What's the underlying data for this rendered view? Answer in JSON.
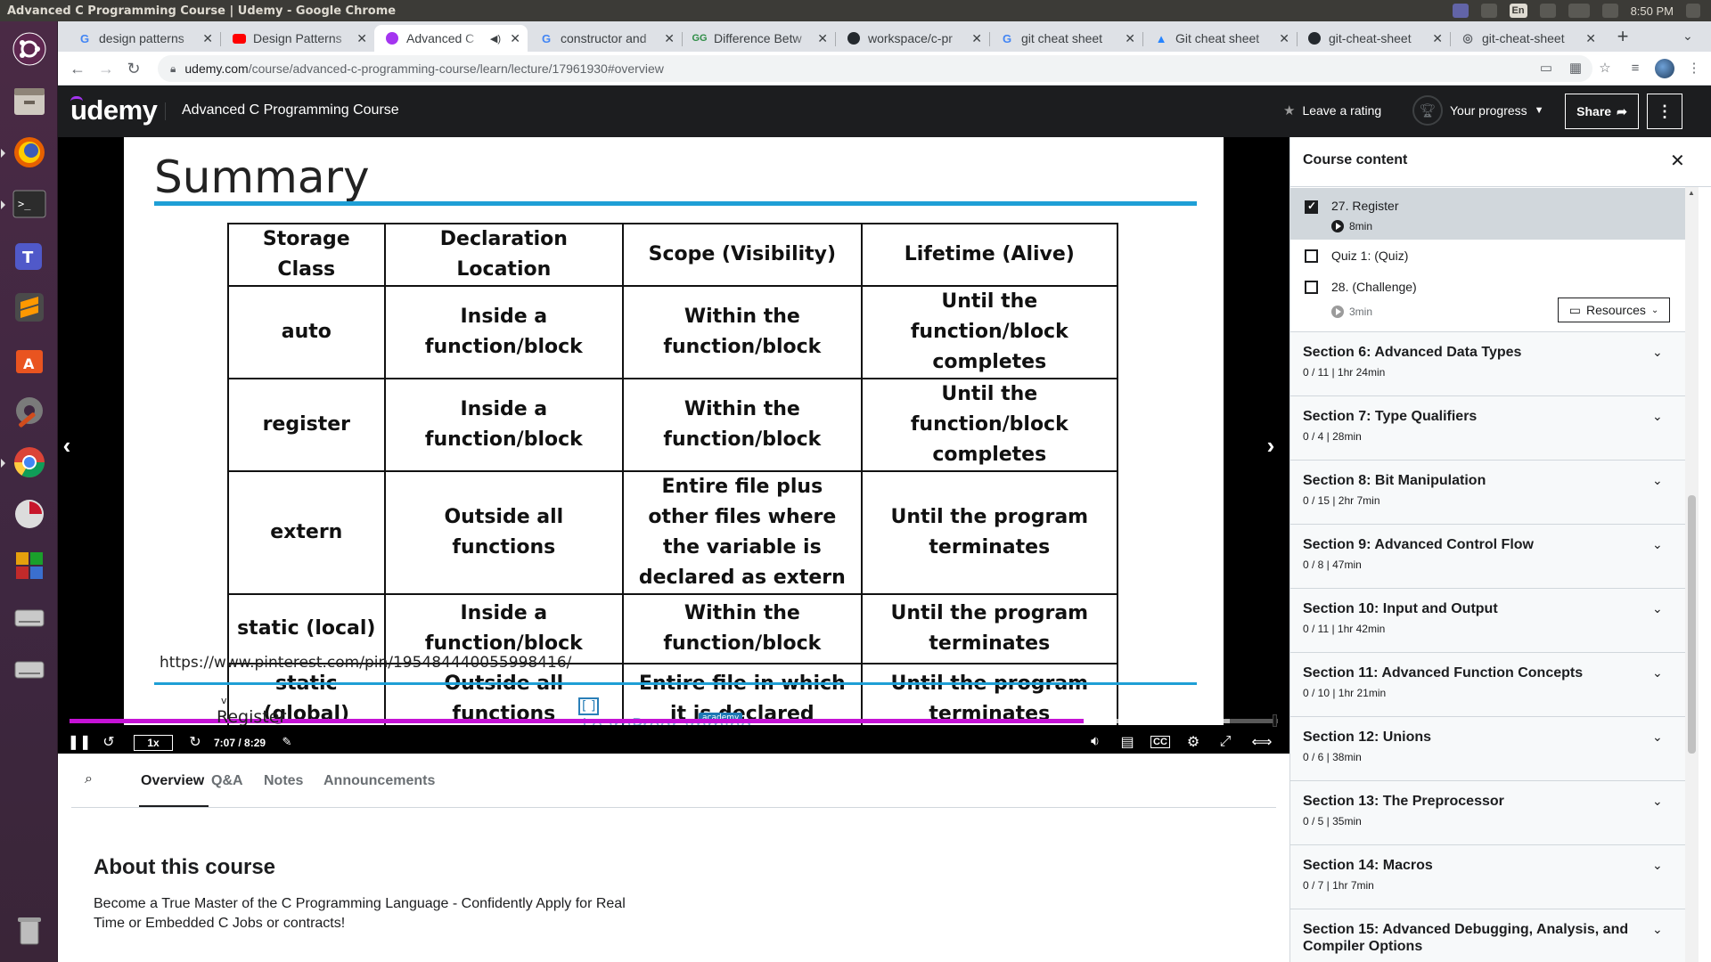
{
  "os": {
    "window_title": "Advanced C Programming Course | Udemy - Google Chrome",
    "clock": "8:50 PM",
    "keyboard_layout": "En"
  },
  "browser": {
    "tabs": [
      {
        "title": "design patterns",
        "favicon": "google-icon",
        "active": false
      },
      {
        "title": "Design Patterns",
        "favicon": "youtube-icon",
        "active": false
      },
      {
        "title": "Advanced C",
        "favicon": "udemy-icon",
        "active": true
      },
      {
        "title": "constructor and",
        "favicon": "google-icon",
        "active": false
      },
      {
        "title": "Difference Betw",
        "favicon": "geeksforgeeks-icon",
        "active": false
      },
      {
        "title": "workspace/c-pr",
        "favicon": "github-icon",
        "active": false
      },
      {
        "title": "git cheat sheet",
        "favicon": "google-icon",
        "active": false
      },
      {
        "title": "Git cheat sheet",
        "favicon": "atlassian-icon",
        "active": false
      },
      {
        "title": "git-cheat-sheet",
        "favicon": "github-icon",
        "active": false
      },
      {
        "title": "git-cheat-sheet",
        "favicon": "globe-icon",
        "active": false
      }
    ],
    "url_host": "udemy.com",
    "url_path": "/course/advanced-c-programming-course/learn/lecture/17961930#overview"
  },
  "header": {
    "logo": "udemy",
    "course_title": "Advanced C Programming Course",
    "leave_rating": "Leave a rating",
    "your_progress": "Your progress",
    "share": "Share"
  },
  "slide": {
    "title": "Summary",
    "table_headers": [
      "Storage Class",
      "Declaration Location",
      "Scope (Visibility)",
      "Lifetime (Alive)"
    ],
    "rows": [
      [
        "auto",
        "Inside a function/block",
        "Within the function/block",
        "Until the function/block completes"
      ],
      [
        "register",
        "Inside a function/block",
        "Within the function/block",
        "Until the function/block completes"
      ],
      [
        "extern",
        "Outside all functions",
        "Entire file plus other files where the variable is declared as extern",
        "Until the program terminates"
      ],
      [
        "static (local)",
        "Inside a function/block",
        "Within the function/block",
        "Until the program terminates"
      ],
      [
        "static (global)",
        "Outside all functions",
        "Entire file in which it is declared",
        "Until the program terminates"
      ]
    ],
    "source_url": "https://www.pinterest.com/pin/195484440055998416/",
    "watermark": "LearnProgramming",
    "watermark_sub": "academy",
    "caption": "Register",
    "caption_mark": "v"
  },
  "player": {
    "speed": "1x",
    "time": "7:07 / 8:29",
    "progress_fraction": 0.839,
    "buffered_fraction": 0.96
  },
  "below_tabs": {
    "overview": "Overview",
    "qa": "Q&A",
    "notes": "Notes",
    "announcements": "Announcements"
  },
  "about": {
    "title": "About this course",
    "text": "Become a True Master of the C Programming Language - Confidently Apply for Real Time or Embedded C Jobs or contracts!"
  },
  "sidebar": {
    "title": "Course content",
    "lectures": [
      {
        "name": "27. Register",
        "duration": "8min",
        "checked": true
      },
      {
        "name": "Quiz 1: (Quiz)",
        "duration": "",
        "checked": false
      },
      {
        "name": "28. (Challenge)",
        "duration": "3min",
        "checked": false,
        "resources": "Resources"
      }
    ],
    "sections": [
      {
        "title": "Section 6: Advanced Data Types",
        "meta": "0 / 11 | 1hr 24min"
      },
      {
        "title": "Section 7: Type Qualifiers",
        "meta": "0 / 4 | 28min"
      },
      {
        "title": "Section 8: Bit Manipulation",
        "meta": "0 / 15 | 2hr 7min"
      },
      {
        "title": "Section 9: Advanced Control Flow",
        "meta": "0 / 8 | 47min"
      },
      {
        "title": "Section 10: Input and Output",
        "meta": "0 / 11 | 1hr 42min"
      },
      {
        "title": "Section 11: Advanced Function Concepts",
        "meta": "0 / 10 | 1hr 21min"
      },
      {
        "title": "Section 12: Unions",
        "meta": "0 / 6 | 38min"
      },
      {
        "title": "Section 13: The Preprocessor",
        "meta": "0 / 5 | 35min"
      },
      {
        "title": "Section 14: Macros",
        "meta": "0 / 7 | 1hr 7min"
      },
      {
        "title": "Section 15: Advanced Debugging, Analysis, and Compiler Options",
        "meta": ""
      }
    ]
  }
}
